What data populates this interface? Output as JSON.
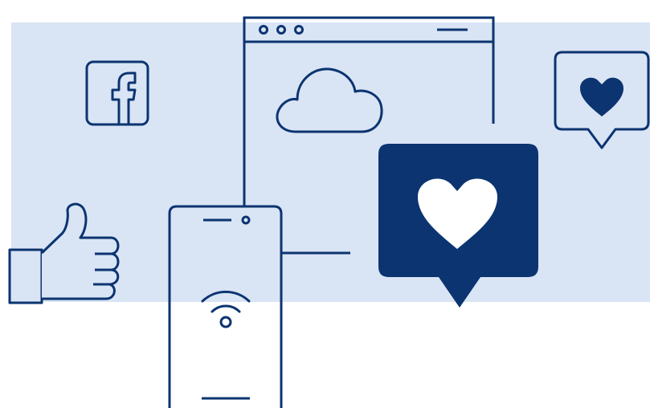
{
  "colors": {
    "navy": "#0b3470",
    "panel": "#d9e4f5",
    "white": "#ffffff"
  },
  "icons": [
    "facebook-icon",
    "thumbs-up-icon",
    "browser-window-icon",
    "cloud-icon",
    "smartphone-icon",
    "wifi-icon",
    "heart-speech-bubble-icon",
    "heart-icon"
  ],
  "facebook_letter": "f"
}
